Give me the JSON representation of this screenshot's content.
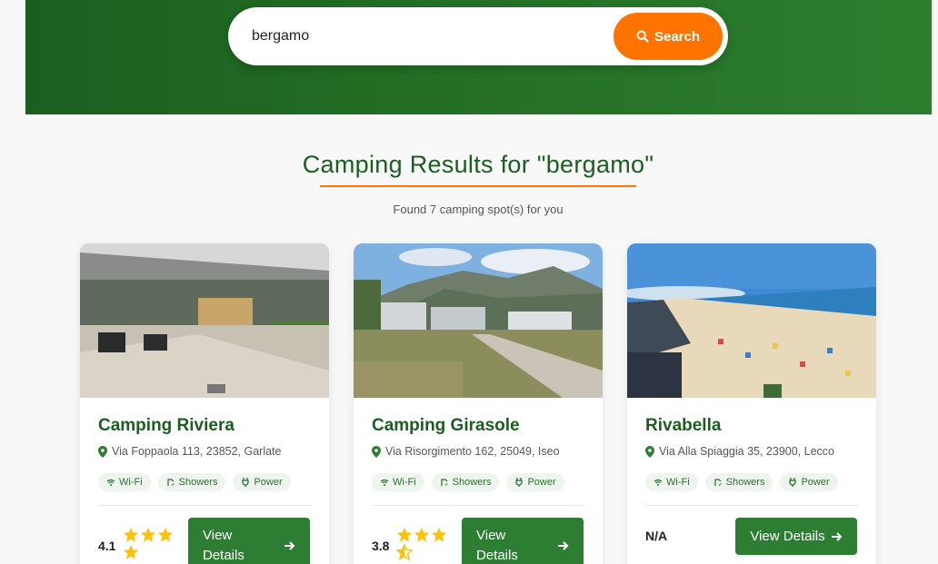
{
  "search": {
    "value": "bergamo",
    "button_label": "Search"
  },
  "results": {
    "title": "Camping Results for \"bergamo\"",
    "count_text": "Found 7 camping spot(s) for you"
  },
  "cards": [
    {
      "name": "Camping Riviera",
      "address": "Via Foppaola 113, 23852, Garlate",
      "amenities": [
        "Wi-Fi",
        "Showers",
        "Power"
      ],
      "rating": "4.1",
      "button": "View Details"
    },
    {
      "name": "Camping Girasole",
      "address": "Via Risorgimento 162, 25049, Iseo",
      "amenities": [
        "Wi-Fi",
        "Showers",
        "Power"
      ],
      "rating": "3.8",
      "button": "View Details"
    },
    {
      "name": "Rivabella",
      "address": "Via Alla Spiaggia 35, 23900, Lecco",
      "amenities": [
        "Wi-Fi",
        "Showers",
        "Power"
      ],
      "rating": "N/A",
      "button": "View Details"
    }
  ],
  "colors": {
    "brand_green": "#2d7d32",
    "accent_orange": "#ff7300",
    "title_green": "#1c5e20"
  },
  "icons": [
    "search-icon",
    "map-pin-icon",
    "wifi-icon",
    "shower-icon",
    "plug-icon",
    "star-icon",
    "arrow-right-icon"
  ]
}
